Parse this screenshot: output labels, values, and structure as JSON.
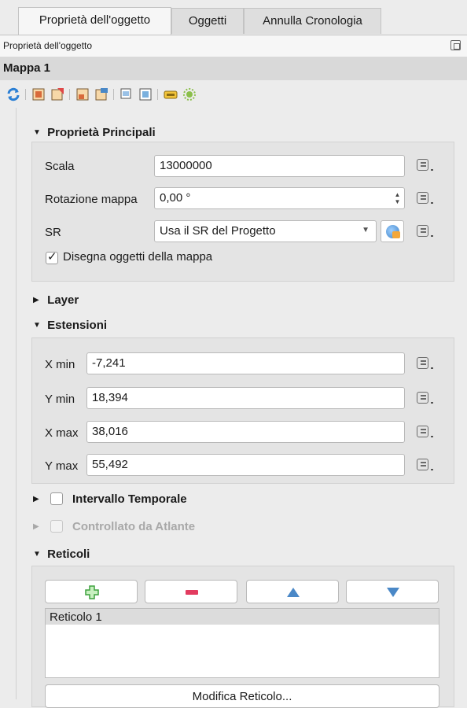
{
  "tabs": [
    {
      "label": "Proprietà dell'oggetto",
      "active": true
    },
    {
      "label": "Oggetti",
      "active": false
    },
    {
      "label": "Annulla Cronologia",
      "active": false
    }
  ],
  "panel": {
    "title": "Proprietà dell'oggetto"
  },
  "item": {
    "name": "Mappa 1"
  },
  "toolbar_icons": [
    "refresh-icon",
    "set-to-canvas-extent-icon",
    "view-extent-in-canvas-icon",
    "set-to-canvas-scale-icon",
    "set-map-scale-icon",
    "lock-layers-icon",
    "lock-styles-icon",
    "label-settings-icon",
    "clipping-settings-icon"
  ],
  "main_props": {
    "header": "Proprietà Principali",
    "scale_label": "Scala",
    "scale_value": "13000000",
    "rotation_label": "Rotazione mappa",
    "rotation_value": "0,00 °",
    "crs_label": "SR",
    "crs_value": "Usa il SR del Progetto",
    "draw_items_label": "Disegna oggetti della mappa",
    "draw_items_checked": true
  },
  "layer_section": {
    "header": "Layer"
  },
  "extents": {
    "header": "Estensioni",
    "rows": [
      {
        "label": "X min",
        "value": "-7,241"
      },
      {
        "label": "Y min",
        "value": "18,394"
      },
      {
        "label": "X max",
        "value": "38,016"
      },
      {
        "label": "Y max",
        "value": "55,492"
      }
    ]
  },
  "temporal": {
    "header": "Intervallo Temporale",
    "checked": false
  },
  "atlas": {
    "header": "Controllato da Atlante",
    "checked": false,
    "enabled": false
  },
  "grids": {
    "header": "Reticoli",
    "items": [
      "Reticolo 1"
    ],
    "edit_label": "Modifica Reticolo..."
  },
  "colors": {
    "add": "#3ea13e",
    "remove": "#e23b5f",
    "arrow": "#4a88c7"
  }
}
